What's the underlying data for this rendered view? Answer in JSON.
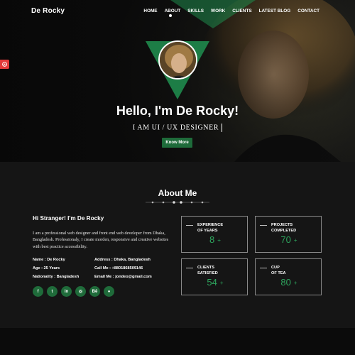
{
  "brand": "De Rocky",
  "nav": [
    "HOME",
    "ABOUT",
    "SKILLS",
    "WORK",
    "CLIENTS",
    "LATEST BLOG",
    "CONTACT"
  ],
  "hero": {
    "title": "Hello, I'm De Rocky!",
    "subtitle": "I AM UI / UX DESIGNER",
    "button": "Know More"
  },
  "about": {
    "title": "About Me",
    "intro_heading": "Hi Stranger! I'm De Rocky",
    "intro_text": "I am a professional web designer and front end web developer from Dhaka, Bangladesh. Professionaly, I create morden, responsive and creative websites with best practice accessibility.",
    "info": {
      "name": "Name : De Rocky",
      "age": "Age : 25 Years",
      "nationality": "Nationality : Bangladesh",
      "address": "Address : Dhaka, Bangladesh",
      "call": "Call Me : +8801868509146",
      "email": "Email Me : jondeo@gmail.com"
    },
    "socials": [
      {
        "icon": "facebook-icon",
        "glyph": "f"
      },
      {
        "icon": "twitter-icon",
        "glyph": "t"
      },
      {
        "icon": "linkedin-icon",
        "glyph": "in"
      },
      {
        "icon": "instagram-icon",
        "glyph": "◎"
      },
      {
        "icon": "behance-icon",
        "glyph": "Bē"
      },
      {
        "icon": "github-icon",
        "glyph": "●"
      }
    ],
    "stats": [
      {
        "label1": "EXPERIENCE",
        "label2": "OF YEARS",
        "value": "8",
        "plus": "+"
      },
      {
        "label1": "PROJECTS",
        "label2": "COMPLETED",
        "value": "70",
        "plus": "+"
      },
      {
        "label1": "CLIENTS",
        "label2": "SATISFIED",
        "value": "54",
        "plus": "+"
      },
      {
        "label1": "CUP",
        "label2": "OF TEA",
        "value": "80",
        "plus": "+"
      }
    ]
  },
  "colors": {
    "accent": "#1f8a4c",
    "stat_value": "#2ea65e",
    "settings": "#e33a3a"
  }
}
